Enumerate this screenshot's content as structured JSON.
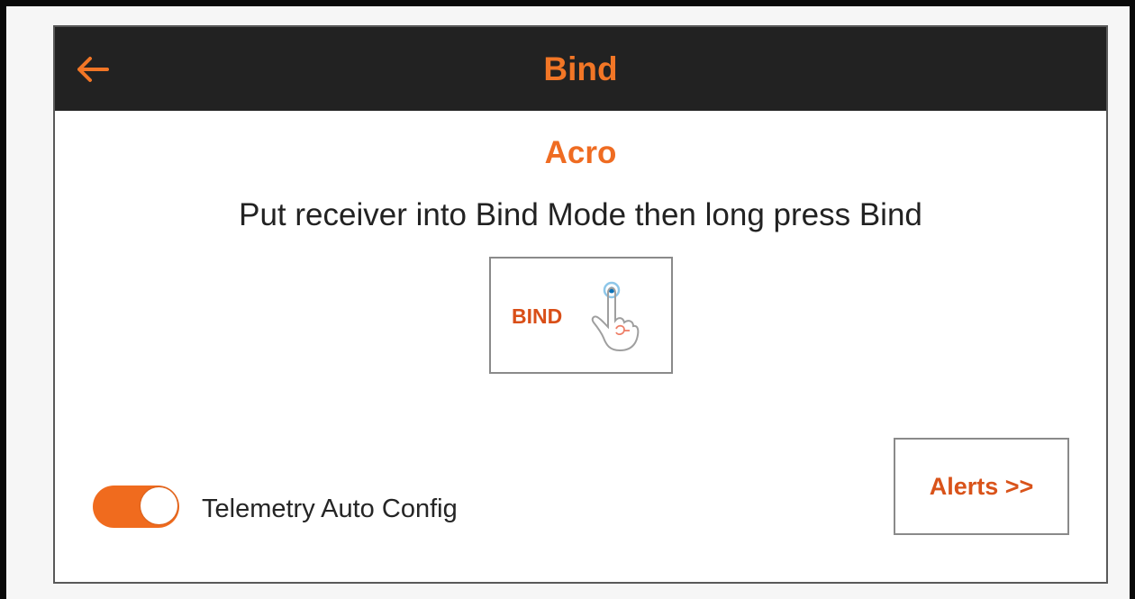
{
  "screen": {
    "title": "Bind",
    "back_icon": "arrow-left-icon",
    "model_name": "Acro",
    "instruction": "Put receiver into Bind Mode then long press Bind",
    "bind_button": {
      "label": "BIND",
      "icon": "touch-hand-icon"
    },
    "telemetry_toggle": {
      "label": "Telemetry Auto Config",
      "state": "on"
    },
    "alerts_button": {
      "label": "Alerts >>"
    }
  },
  "colors": {
    "accent": "#f27626",
    "title_bar": "#222222",
    "button_text": "#d94f18",
    "border": "#8a8a8a"
  }
}
